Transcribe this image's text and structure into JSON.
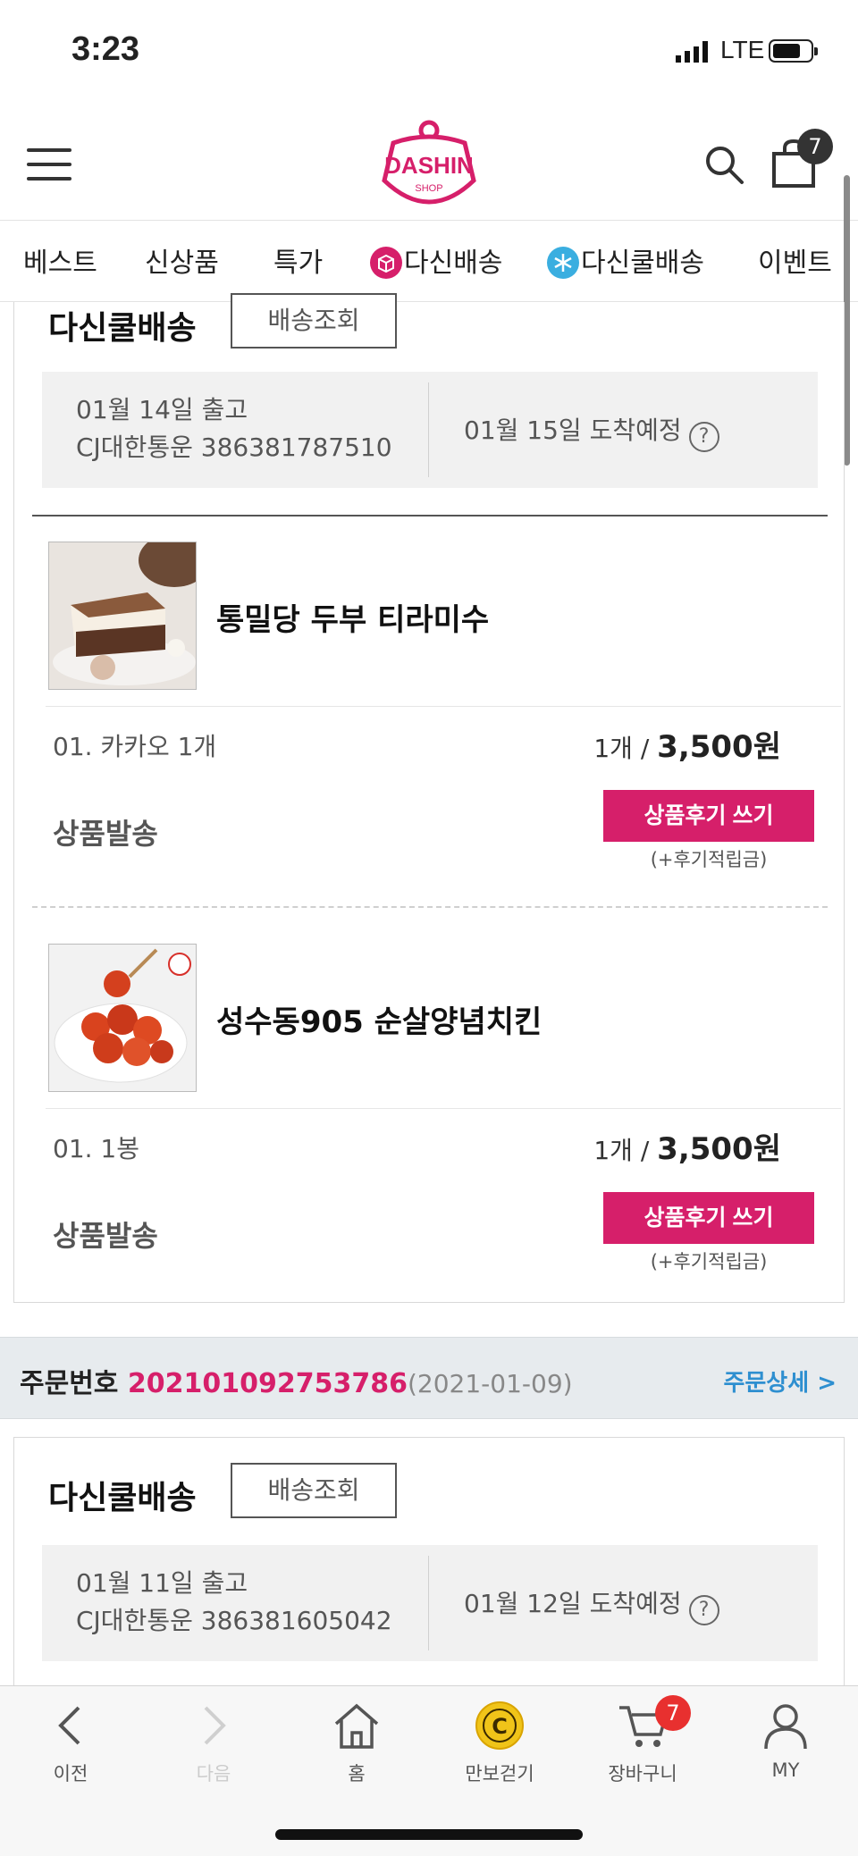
{
  "status_bar": {
    "time": "3:23",
    "network": "LTE"
  },
  "header": {
    "logo_text": "DASHIN",
    "logo_sub": "SHOP",
    "cart_count": "7"
  },
  "categories": [
    "베스트",
    "신상품",
    "특가",
    "다신배송",
    "다신쿨배송",
    "이벤트"
  ],
  "shipment1": {
    "title": "다신쿨배송",
    "track_label": "배송조회",
    "ship_date": "01월 14일 출고",
    "carrier_tracking": "CJ대한통운 386381787510",
    "arrival": "01월 15일 도착예정",
    "items": [
      {
        "name": "통밀당 두부 티라미수",
        "option": "01. 카카오 1개",
        "qty": "1개",
        "price": "3,500원",
        "status": "상품발송",
        "review_label": "상품후기 쓰기",
        "review_sub": "(+후기적립금)"
      },
      {
        "name": "성수동905 순살양념치킨",
        "option": "01. 1봉",
        "qty": "1개",
        "price": "3,500원",
        "status": "상품발송",
        "review_label": "상품후기 쓰기",
        "review_sub": "(+후기적립금)"
      }
    ]
  },
  "order": {
    "label": "주문번호",
    "number": "202101092753786",
    "date": "(2021-01-09)",
    "detail_link": "주문상세 >"
  },
  "shipment2": {
    "title": "다신쿨배송",
    "track_label": "배송조회",
    "ship_date": "01월 11일 출고",
    "carrier_tracking": "CJ대한통운 386381605042",
    "arrival": "01월 12일 도착예정"
  },
  "bottom_nav": {
    "prev": "이전",
    "next": "다음",
    "home": "홈",
    "walk": "만보걷기",
    "cart": "장바구니",
    "cart_count": "7",
    "my": "MY"
  },
  "colors": {
    "accent": "#d61f6a",
    "link": "#2e8fd0",
    "badge": "#e8302f"
  },
  "icons": [
    "hamburger-icon",
    "search-icon",
    "shopping-bag-icon",
    "box-icon",
    "snowflake-icon",
    "help-icon",
    "chevron-left-icon",
    "chevron-right-icon",
    "home-icon",
    "coin-icon",
    "cart-icon",
    "user-icon"
  ]
}
